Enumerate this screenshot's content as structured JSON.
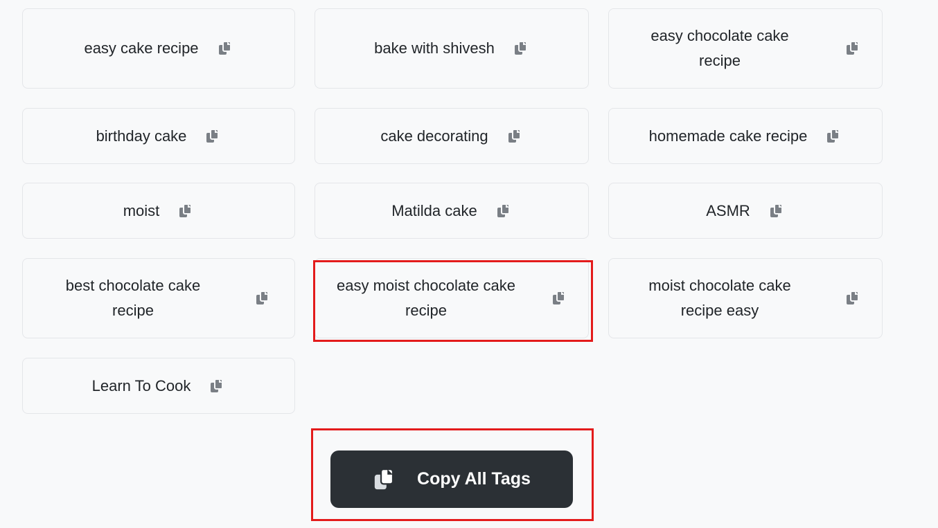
{
  "tags": [
    {
      "label": "easy cake recipe"
    },
    {
      "label": "bake with shivesh"
    },
    {
      "label": "easy chocolate cake recipe"
    },
    {
      "label": "birthday cake"
    },
    {
      "label": "cake decorating"
    },
    {
      "label": "homemade cake recipe"
    },
    {
      "label": "moist"
    },
    {
      "label": "Matilda cake"
    },
    {
      "label": "ASMR"
    },
    {
      "label": "best chocolate cake recipe"
    },
    {
      "label": "easy moist chocolate cake recipe"
    },
    {
      "label": "moist chocolate cake recipe easy"
    },
    {
      "label": "Learn To Cook"
    }
  ],
  "copy_all": {
    "label": "Copy All Tags",
    "icon": "copy-icon"
  },
  "colors": {
    "highlight": "#e31b1b",
    "button_bg": "#2b3035",
    "icon_gray": "#7a7f85"
  }
}
